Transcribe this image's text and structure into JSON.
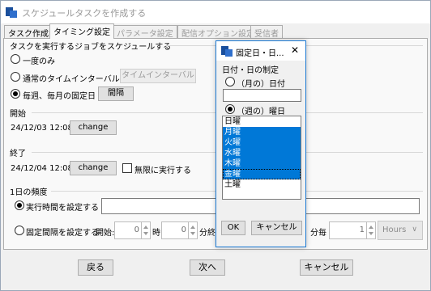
{
  "window": {
    "title": "スケジュールタスクを作成する"
  },
  "tabs": [
    {
      "label": "タスク作成",
      "state": "normal"
    },
    {
      "label": "タイミング設定",
      "state": "active"
    },
    {
      "label": "パラメータ設定",
      "state": "disabled"
    },
    {
      "label": "配信オプション設定",
      "state": "disabled"
    },
    {
      "label": "受信者",
      "state": "disabled"
    }
  ],
  "schedule": {
    "heading": "タスクを実行するジョブをスケジュールする",
    "once_label": "一度のみ",
    "interval_label": "通常のタイムインターバルにて",
    "interval_button": "タイムインターバル",
    "fixed_label": "毎週、毎月の固定日",
    "fixed_button": "間隔"
  },
  "start": {
    "heading": "開始",
    "datetime": "24/12/03 12:08",
    "change_button": "change"
  },
  "end": {
    "heading": "終了",
    "datetime": "24/12/04 12:08",
    "change_button": "change",
    "infinite_label": "無限に実行する"
  },
  "daily": {
    "heading": "1日の頻度",
    "exec_time_label": "実行時間を設定する",
    "exec_time_value": "",
    "fixed_interval_label": "固定間隔を設定する",
    "start_label": "開始:",
    "hour_value": "0",
    "hour_unit": "時",
    "min_value": "0",
    "min_unit": "分終",
    "every_label": "分毎",
    "every_value": "1",
    "unit_select": "Hours"
  },
  "footer": {
    "back": "戻る",
    "next": "次へ",
    "cancel": "キャンセル"
  },
  "dialog": {
    "title": "固定日・日...",
    "section": "日付・日の制定",
    "month_day_label": "（月の）日付",
    "month_day_value": "",
    "weekday_label": "（週の）曜日",
    "weekdays": [
      {
        "label": "日曜",
        "selected": false
      },
      {
        "label": "月曜",
        "selected": true
      },
      {
        "label": "火曜",
        "selected": true
      },
      {
        "label": "水曜",
        "selected": true
      },
      {
        "label": "木曜",
        "selected": true
      },
      {
        "label": "金曜",
        "selected": true
      },
      {
        "label": "土曜",
        "selected": false
      }
    ],
    "ok": "OK",
    "cancel": "キャンセル"
  },
  "colors": {
    "accent": "#0078d7",
    "dialog_border": "#1c7ad4",
    "brand_icon": "#1a4f9c"
  }
}
